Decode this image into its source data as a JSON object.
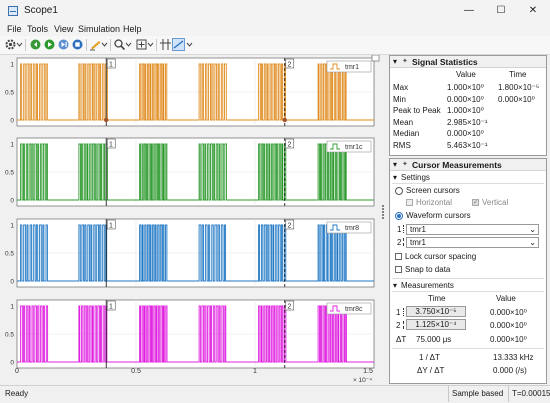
{
  "window": {
    "title": "Scope1",
    "minimize": "—",
    "maximize": "☐",
    "close": "✕"
  },
  "menu": [
    "File",
    "Tools",
    "View",
    "Simulation",
    "Help"
  ],
  "toolbar": {
    "icons": [
      "gear-icon",
      "chevron-down-icon",
      "run-back-icon",
      "play-icon",
      "step-icon",
      "stop-icon",
      "highlight-icon",
      "chevron-down-icon",
      "zoom-icon",
      "chevron-down-icon",
      "fit-icon",
      "chevron-down-icon",
      "cursor-measure-icon",
      "style-icon",
      "chevron-down-icon"
    ]
  },
  "plots": {
    "y_ticks": [
      "1",
      "0.5",
      "0"
    ],
    "x_ticks": [
      "0",
      "0.5",
      "1",
      "1.5"
    ],
    "x_exponent": "× 10⁻⁴",
    "cursor_labels": [
      "1",
      "2"
    ],
    "cursor_t": [
      0.375,
      1.125
    ],
    "xmax": 1.5,
    "signals": [
      {
        "name": "tmr1",
        "color": "#e08b1e"
      },
      {
        "name": "tmr1c",
        "color": "#2e9a2e"
      },
      {
        "name": "tmr8",
        "color": "#1f77c4"
      },
      {
        "name": "tmr8c",
        "color": "#e020e0"
      }
    ]
  },
  "signal_statistics": {
    "title": "Signal Statistics",
    "col_value": "Value",
    "col_time": "Time",
    "rows": [
      {
        "label": "Max",
        "value": "1.000×10⁰",
        "time": "1.800×10⁻⁵"
      },
      {
        "label": "Min",
        "value": "0.000×10⁰",
        "time": "0.000×10⁰"
      },
      {
        "label": "Peak to Peak",
        "value": "1.000×10⁰",
        "time": ""
      },
      {
        "label": "Mean",
        "value": "2.985×10⁻¹",
        "time": ""
      },
      {
        "label": "Median",
        "value": "0.000×10⁰",
        "time": ""
      },
      {
        "label": "RMS",
        "value": "5.463×10⁻¹",
        "time": ""
      }
    ]
  },
  "cursor_measurements": {
    "title": "Cursor Measurements",
    "settings_label": "Settings",
    "screen_cursors": "Screen cursors",
    "horizontal": "Horizontal",
    "vertical": "Vertical",
    "waveform_cursors": "Waveform cursors",
    "cursor1_index": "1",
    "cursor2_index": "2",
    "cursor1_signal": "tmr1",
    "cursor2_signal": "tmr1",
    "lock_spacing": "Lock cursor spacing",
    "snap": "Snap to data",
    "measurements_label": "Measurements",
    "col_time": "Time",
    "col_value": "Value",
    "c1_time": "3.750×10⁻⁵",
    "c1_value": "0.000×10⁰",
    "c2_time": "1.125×10⁻⁴",
    "c2_value": "0.000×10⁰",
    "dt_label": "ΔT",
    "dt_value": "75.000 μs",
    "dt_dy": "0.000×10⁰",
    "inv_dt_label": "1 / ΔT",
    "inv_dt_value": "13.333 kHz",
    "dy_dt_label": "ΔY / ΔT",
    "dy_dt_value": "0.000 (/s)"
  },
  "status": {
    "ready": "Ready",
    "sample": "Sample based",
    "time": "T=0.00015"
  }
}
